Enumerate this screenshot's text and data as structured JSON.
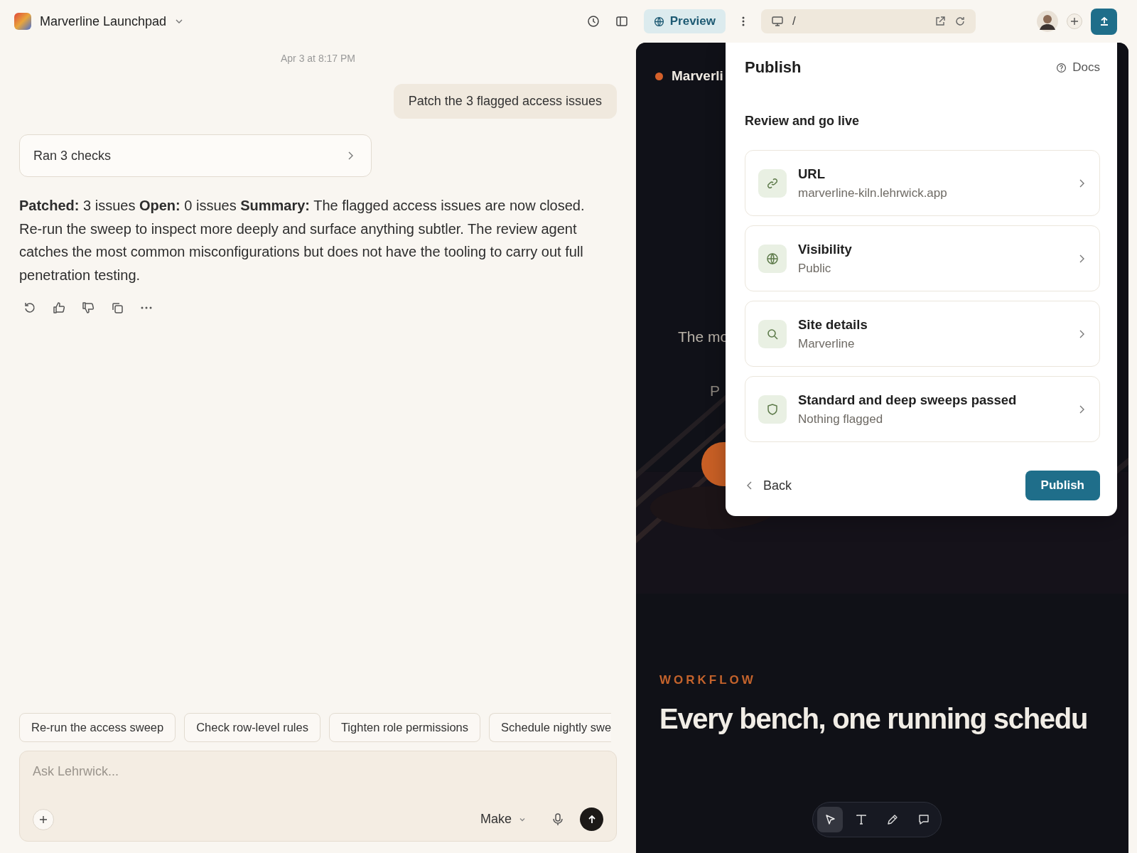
{
  "topbar": {
    "project": "Marverline Launchpad",
    "preview_tab": {
      "label": "Preview",
      "selected": true
    },
    "url_path": "/"
  },
  "chat": {
    "timestamp": "Apr 3 at 8:17 PM",
    "user_message": "Patch the 3 flagged access issues",
    "tool_card": "Ran 3 checks",
    "reply": "**Patched:** 3 issues **Open:** 0 issues **Summary:** The flagged access issues are now closed. Re-run the sweep to inspect more deeply and surface anything subtler. The review agent catches the most common misconfigurations but does not have the tooling to carry out full penetration testing.",
    "suggestions": [
      "Re-run the access sweep",
      "Check row-level rules",
      "Tighten role permissions",
      "Schedule nightly swe"
    ],
    "composer": {
      "placeholder": "Ask Lehrwick...",
      "mode": "Make"
    }
  },
  "preview": {
    "site_name": "Marverli",
    "subtitle": "The mo",
    "fragment": "P",
    "eyebrow": "WORKFLOW",
    "headline": "Every bench, one running schedu",
    "tools": [
      {
        "kind": "pointer",
        "selected": true
      },
      {
        "kind": "text",
        "selected": false
      },
      {
        "kind": "pen",
        "selected": false
      },
      {
        "kind": "comment",
        "selected": false
      }
    ]
  },
  "publish_panel": {
    "title": "Publish",
    "docs": "Docs",
    "subtitle": "Review and go live",
    "items": [
      {
        "kind": "link",
        "title": "URL",
        "value": "marverline-kiln.lehrwick.app"
      },
      {
        "kind": "globe",
        "title": "Visibility",
        "value": "Public"
      },
      {
        "kind": "search",
        "title": "Site details",
        "value": "Marverline"
      },
      {
        "kind": "shield",
        "title": "Standard and deep sweeps passed",
        "value": "Nothing flagged"
      }
    ],
    "back": "Back",
    "publish": "Publish"
  }
}
